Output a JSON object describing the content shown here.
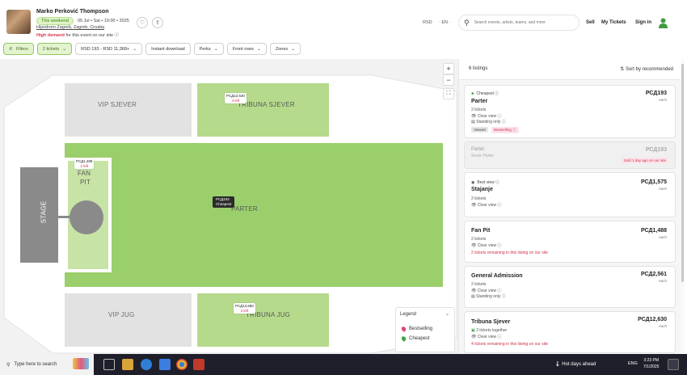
{
  "header": {
    "event_title": "Marko Perković Thompson",
    "weekend_badge": "This weekend",
    "date": "05 Jul • Sat • 19:00 • 2025",
    "venue": "Hipodrom Zagreb, Zagreb, Croatia",
    "demand_strong": "High demand",
    "demand_rest": " for this event on our site ⓘ",
    "currency": "RSD",
    "language": "EN",
    "search_placeholder": "Search events, artists, teams, and more",
    "nav_sell": "Sell",
    "nav_my_tickets": "My Tickets",
    "nav_sign_in": "Sign in"
  },
  "filters": [
    {
      "label": "Filters",
      "icon": "sliders-icon",
      "active": true
    },
    {
      "label": "2 tickets",
      "active": true
    },
    {
      "label": "RSD 193 - RSD 11,368+"
    },
    {
      "label": "Instant download"
    },
    {
      "label": "Perks"
    },
    {
      "label": "Front rows"
    },
    {
      "label": "Zones"
    }
  ],
  "map": {
    "sections": {
      "vip_sjever": "VIP SJEVER",
      "tribuna_sjever": "TRIBUNA SJEVER",
      "fan_pit_1": "FAN",
      "fan_pit_2": "PIT",
      "stage": "STAGE",
      "parter": "PARTER",
      "vip_jug": "VIP JUG",
      "tribuna_jug": "TRIBUNA JUG"
    },
    "pins": {
      "tribuna_sjever": {
        "price": "РСД12,630",
        "left": "4 left"
      },
      "fan_pit": {
        "price": "РСД1,488",
        "left": "2 left"
      },
      "parter": {
        "price": "РСД193",
        "note": "Cheapest"
      },
      "tribuna_jug": {
        "price": "РСД13,680",
        "left": "3 left"
      }
    },
    "zoom_in": "+",
    "zoom_out": "−",
    "legend": {
      "title": "Legend",
      "items": [
        {
          "label": "Bestselling",
          "color": "#e0457b"
        },
        {
          "label": "Cheapest",
          "color": "#3fa54a"
        }
      ]
    }
  },
  "listings": {
    "count": "6 listings",
    "sort_label": "Sort by recommended",
    "cards": [
      {
        "tag": "Cheapest ⓘ",
        "name": "Parter",
        "price": "РСД193",
        "each": "each",
        "qty": "2 tickets",
        "feat1": "Clear view ⓘ",
        "feat2": "Standing only ⓘ",
        "badge1": "Viewed",
        "badge2": "Bestselling ⓘ"
      },
      {
        "name": "Parter",
        "sub": "Sever Parter",
        "price": "РСД193",
        "sold": "Sold 1 day ago on our site"
      },
      {
        "tag": "Best view ⓘ",
        "name": "Stajanje",
        "price": "РСД1,575",
        "each": "each",
        "qty": "2 tickets",
        "feat1": "Clear view ⓘ"
      },
      {
        "name": "Fan Pit",
        "price": "РСД1,488",
        "each": "each",
        "qty": "2 tickets",
        "feat1": "Clear view ⓘ",
        "remaining": "2 tickets remaining in this listing on our site"
      },
      {
        "name": "General Admission",
        "price": "РСД2,561",
        "each": "each",
        "qty": "2 tickets",
        "feat1": "Clear view ⓘ",
        "feat2": "Standing only ⓘ"
      },
      {
        "name": "Tribuna Sjever",
        "price": "РСД12,630",
        "each": "each",
        "qty": "2 tickets together",
        "feat1": "Clear view ⓘ",
        "remaining": "4 tickets remaining in this listing on our site"
      }
    ]
  },
  "taskbar": {
    "search": "Type here to search",
    "weather": "Hot days ahead",
    "lang": "ENG",
    "time": "3:23 PM",
    "date": "7/1/2025"
  },
  "colors": {
    "accent_green": "#8ec761",
    "section_green": "#b5da8c",
    "pit_green": "#c7e3a6",
    "vip_grey": "#e3e3e3",
    "stage_grey": "#8a8a8a",
    "red_text": "#d0304a"
  }
}
